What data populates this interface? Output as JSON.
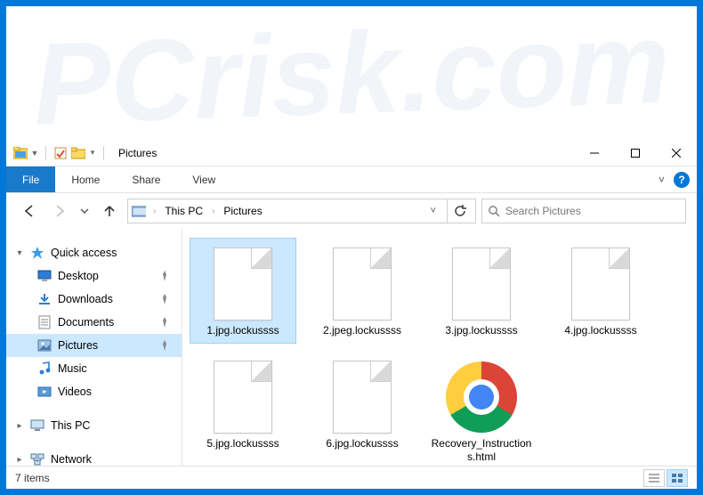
{
  "window": {
    "title": "Pictures",
    "controls": {
      "minimize": "—",
      "maximize": "▢",
      "close": "✕"
    }
  },
  "qat": {
    "explorer_icon": "explorer",
    "properties_icon": "properties",
    "newfolder_icon": "new-folder"
  },
  "ribbon": {
    "file": "File",
    "tabs": [
      "Home",
      "Share",
      "View"
    ],
    "expand_hint": "˅",
    "help": "?"
  },
  "nav": {
    "back": "←",
    "forward": "→",
    "recent": "˅",
    "up": "↑"
  },
  "breadcrumb": {
    "root_icon": "this-pc",
    "parts": [
      "This PC",
      "Pictures"
    ],
    "dropdown": "˅",
    "refresh": "refresh"
  },
  "search": {
    "icon": "search",
    "placeholder": "Search Pictures"
  },
  "sidebar": {
    "quick_access": {
      "label": "Quick access",
      "expanded": true,
      "items": [
        {
          "label": "Desktop",
          "icon": "desktop",
          "pinned": true
        },
        {
          "label": "Downloads",
          "icon": "downloads",
          "pinned": true
        },
        {
          "label": "Documents",
          "icon": "documents",
          "pinned": true
        },
        {
          "label": "Pictures",
          "icon": "pictures",
          "pinned": true,
          "active": true
        },
        {
          "label": "Music",
          "icon": "music",
          "pinned": false
        },
        {
          "label": "Videos",
          "icon": "videos",
          "pinned": false
        }
      ]
    },
    "this_pc": {
      "label": "This PC",
      "icon": "this-pc"
    },
    "network": {
      "label": "Network",
      "icon": "network"
    }
  },
  "files": [
    {
      "name": "1.jpg.lockussss",
      "kind": "blank",
      "selected": true
    },
    {
      "name": "2.jpeg.lockussss",
      "kind": "blank"
    },
    {
      "name": "3.jpg.lockussss",
      "kind": "blank"
    },
    {
      "name": "4.jpg.lockussss",
      "kind": "blank"
    },
    {
      "name": "5.jpg.lockussss",
      "kind": "blank"
    },
    {
      "name": "6.jpg.lockussss",
      "kind": "blank"
    },
    {
      "name": "Recovery_Instructions.html",
      "kind": "chrome"
    }
  ],
  "status": {
    "count_text": "7 items",
    "view_details": "details",
    "view_large": "large-icons"
  },
  "watermark": "PCrisk.com",
  "icon_glyphs": {
    "pin": "📌",
    "search": "🔍"
  }
}
